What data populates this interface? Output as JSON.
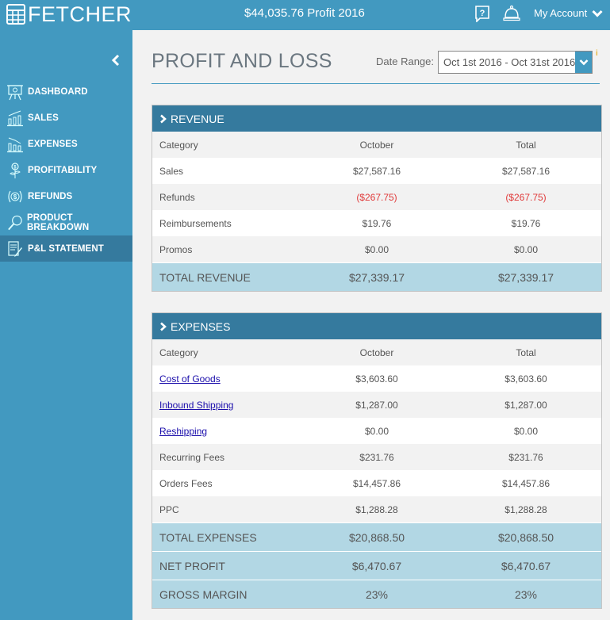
{
  "app": {
    "logo": "FETCHER",
    "profit_summary": "$44,035.76 Profit 2016",
    "account_label": "My Account",
    "icons": {
      "logo": "calculator-icon",
      "help": "help-question-icon",
      "notifications": "service-bell-icon",
      "account_menu": "chevron-down-icon",
      "collapse": "chevron-left-icon"
    }
  },
  "sidebar": {
    "items": [
      {
        "label": "DASHBOARD",
        "icon": "presentation-board-icon",
        "active": false
      },
      {
        "label": "SALES",
        "icon": "bar-chart-up-icon",
        "active": false
      },
      {
        "label": "EXPENSES",
        "icon": "bar-chart-down-icon",
        "active": false
      },
      {
        "label": "PROFITABILITY",
        "icon": "money-plant-icon",
        "active": false
      },
      {
        "label": "REFUNDS",
        "icon": "dollar-exchange-icon",
        "active": false
      },
      {
        "label": "PRODUCT BREAKDOWN",
        "icon": "magnifier-icon",
        "active": false
      },
      {
        "label": "P&L STATEMENT",
        "icon": "document-pen-icon",
        "active": true
      }
    ]
  },
  "page": {
    "title": "PROFIT AND LOSS",
    "date_range_label": "Date Range:",
    "date_range_value": "Oct 1st 2016 - Oct 31st 2016",
    "info_mark": "i"
  },
  "revenue": {
    "title": "REVENUE",
    "columns": [
      "Category",
      "October",
      "Total"
    ],
    "rows": [
      {
        "category": "Sales",
        "october": "$27,587.16",
        "total": "$27,587.16"
      },
      {
        "category": "Refunds",
        "october": "($267.75)",
        "total": "($267.75)",
        "negative": true
      },
      {
        "category": "Reimbursements",
        "october": "$19.76",
        "total": "$19.76"
      },
      {
        "category": "Promos",
        "october": "$0.00",
        "total": "$0.00"
      }
    ],
    "totals": [
      {
        "label": "TOTAL REVENUE",
        "october": "$27,339.17",
        "total": "$27,339.17"
      }
    ]
  },
  "expenses": {
    "title": "EXPENSES",
    "columns": [
      "Category",
      "October",
      "Total"
    ],
    "rows": [
      {
        "category": "Cost of Goods",
        "october": "$3,603.60",
        "total": "$3,603.60",
        "link": true
      },
      {
        "category": "Inbound Shipping",
        "october": "$1,287.00",
        "total": "$1,287.00",
        "link": true
      },
      {
        "category": "Reshipping",
        "october": "$0.00",
        "total": "$0.00",
        "link": true
      },
      {
        "category": "Recurring Fees",
        "october": "$231.76",
        "total": "$231.76"
      },
      {
        "category": "Orders Fees",
        "october": "$14,457.86",
        "total": "$14,457.86"
      },
      {
        "category": "PPC",
        "october": "$1,288.28",
        "total": "$1,288.28"
      }
    ],
    "totals": [
      {
        "label": "TOTAL EXPENSES",
        "october": "$20,868.50",
        "total": "$20,868.50"
      },
      {
        "label": "NET PROFIT",
        "october": "$6,470.67",
        "total": "$6,470.67"
      },
      {
        "label": "GROSS MARGIN",
        "october": "23%",
        "total": "23%"
      }
    ]
  }
}
